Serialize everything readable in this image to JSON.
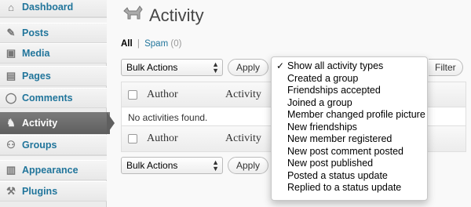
{
  "sidebar": {
    "items": [
      {
        "label": "Dashboard",
        "icon": "dashboard-icon",
        "glyph": "⌂"
      },
      {
        "label": "Posts",
        "icon": "pushpin-icon",
        "glyph": "✎"
      },
      {
        "label": "Media",
        "icon": "media-icon",
        "glyph": "▣"
      },
      {
        "label": "Pages",
        "icon": "pages-icon",
        "glyph": "▤"
      },
      {
        "label": "Comments",
        "icon": "comments-icon",
        "glyph": "◯"
      },
      {
        "label": "Activity",
        "icon": "activity-icon",
        "glyph": "♞"
      },
      {
        "label": "Groups",
        "icon": "groups-icon",
        "glyph": "⚇"
      },
      {
        "label": "Appearance",
        "icon": "appearance-icon",
        "glyph": "▥"
      },
      {
        "label": "Plugins",
        "icon": "plugins-icon",
        "glyph": "⚒"
      }
    ]
  },
  "header": {
    "title": "Activity"
  },
  "filters": {
    "all_label": "All",
    "separator": "|",
    "spam_label": "Spam",
    "spam_count": "(0)"
  },
  "bulk_top": {
    "select_value": "Bulk Actions",
    "apply_label": "Apply"
  },
  "bulk_bottom": {
    "select_value": "Bulk Actions",
    "apply_label": "Apply"
  },
  "filter_button": {
    "label": "Filter"
  },
  "table": {
    "columns": [
      "Author",
      "Activity"
    ],
    "empty_message": "No activities found."
  },
  "dropdown": {
    "options": [
      "Show all activity types",
      "Created a group",
      "Friendships accepted",
      "Joined a group",
      "Member changed profile picture",
      "New friendships",
      "New member registered",
      "New post comment posted",
      "New post published",
      "Posted a status update",
      "Replied to a status update"
    ],
    "selected": "Show all activity types"
  },
  "colors": {
    "link": "#21759b",
    "active_menu": "#6a6a6a"
  }
}
